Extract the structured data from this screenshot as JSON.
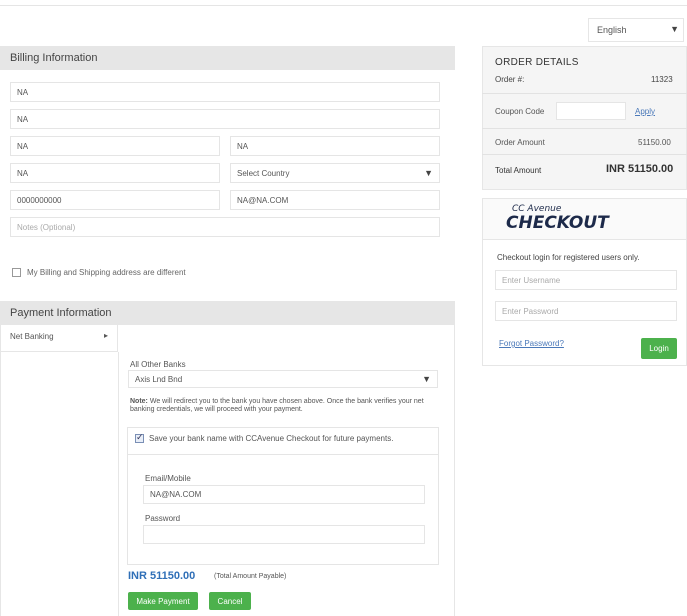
{
  "language": {
    "selected": "English"
  },
  "billing": {
    "heading": "Billing Information",
    "fields": {
      "name": "NA",
      "address": "NA",
      "city": "NA",
      "state": "NA",
      "zip": "NA",
      "country": "Select Country",
      "phone": "0000000000",
      "email": "NA@NA.COM",
      "notes_placeholder": "Notes (Optional)"
    },
    "shipping_toggle_label": "My Billing and Shipping address are different"
  },
  "payment": {
    "heading": "Payment Information",
    "method": "Net Banking",
    "bank_group_label": "All Other Banks",
    "bank_selected": "Axis Lnd Bnd",
    "note_prefix": "Note:",
    "note_text": "We will redirect you to the bank you have chosen above. Once the bank verifies your net banking credentials, we will proceed with your payment.",
    "save_checkbox_label": "Save your bank name with CCAvenue Checkout for future payments.",
    "email_label": "Email/Mobile",
    "email_value": "NA@NA.COM",
    "password_label": "Password",
    "amount": "INR 51150.00",
    "amount_note": "(Total Amount Payable)",
    "make_payment_label": "Make Payment",
    "cancel_label": "Cancel"
  },
  "order": {
    "heading": "ORDER DETAILS",
    "order_no_label": "Order #:",
    "order_no": "11323",
    "coupon_label": "Coupon Code",
    "apply_label": "Apply",
    "amount_label": "Order Amount",
    "amount_value": "51150.00",
    "total_label": "Total Amount",
    "total_value": "INR 51150.00"
  },
  "checkout_login": {
    "logo_small": "CC Avenue",
    "logo_big": "CHECKOUT",
    "title": "Checkout login for registered users only.",
    "username_placeholder": "Enter Username",
    "password_placeholder": "Enter Password",
    "forgot_label": "Forgot Password?",
    "login_label": "Login"
  },
  "colors": {
    "accent_green": "#4cb14c",
    "link_blue": "#4b79b9",
    "panel_grey": "#e6e6e6"
  }
}
